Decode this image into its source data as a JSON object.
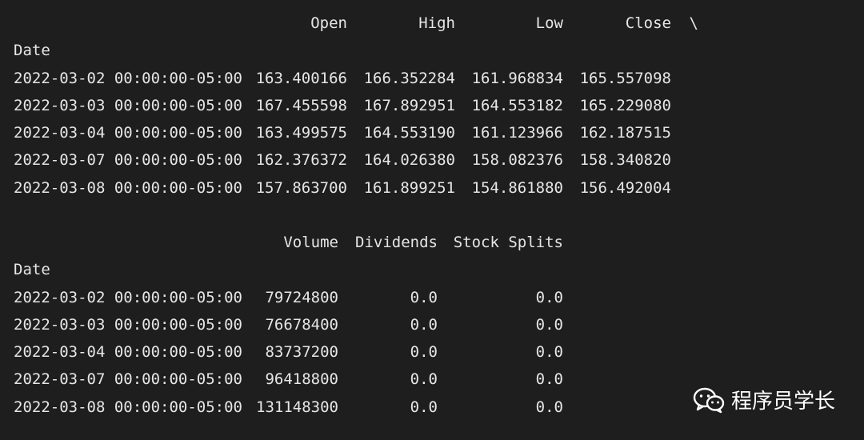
{
  "table1": {
    "header": [
      "Open",
      "High",
      "Low",
      "Close",
      "\\"
    ],
    "index_name": "Date",
    "rows": [
      {
        "date": "2022-03-02 00:00:00-05:00",
        "values": [
          "163.400166",
          "166.352284",
          "161.968834",
          "165.557098"
        ]
      },
      {
        "date": "2022-03-03 00:00:00-05:00",
        "values": [
          "167.455598",
          "167.892951",
          "164.553182",
          "165.229080"
        ]
      },
      {
        "date": "2022-03-04 00:00:00-05:00",
        "values": [
          "163.499575",
          "164.553190",
          "161.123966",
          "162.187515"
        ]
      },
      {
        "date": "2022-03-07 00:00:00-05:00",
        "values": [
          "162.376372",
          "164.026380",
          "158.082376",
          "158.340820"
        ]
      },
      {
        "date": "2022-03-08 00:00:00-05:00",
        "values": [
          "157.863700",
          "161.899251",
          "154.861880",
          "156.492004"
        ]
      }
    ]
  },
  "table2": {
    "header": [
      "Volume",
      "Dividends",
      "Stock Splits"
    ],
    "index_name": "Date",
    "rows": [
      {
        "date": "2022-03-02 00:00:00-05:00",
        "values": [
          "79724800",
          "0.0",
          "0.0"
        ]
      },
      {
        "date": "2022-03-03 00:00:00-05:00",
        "values": [
          "76678400",
          "0.0",
          "0.0"
        ]
      },
      {
        "date": "2022-03-04 00:00:00-05:00",
        "values": [
          "83737200",
          "0.0",
          "0.0"
        ]
      },
      {
        "date": "2022-03-07 00:00:00-05:00",
        "values": [
          "96418800",
          "0.0",
          "0.0"
        ]
      },
      {
        "date": "2022-03-08 00:00:00-05:00",
        "values": [
          "131148300",
          "0.0",
          "0.0"
        ]
      }
    ]
  },
  "watermark": {
    "text": "程序员学长",
    "icon": "wechat-icon"
  }
}
